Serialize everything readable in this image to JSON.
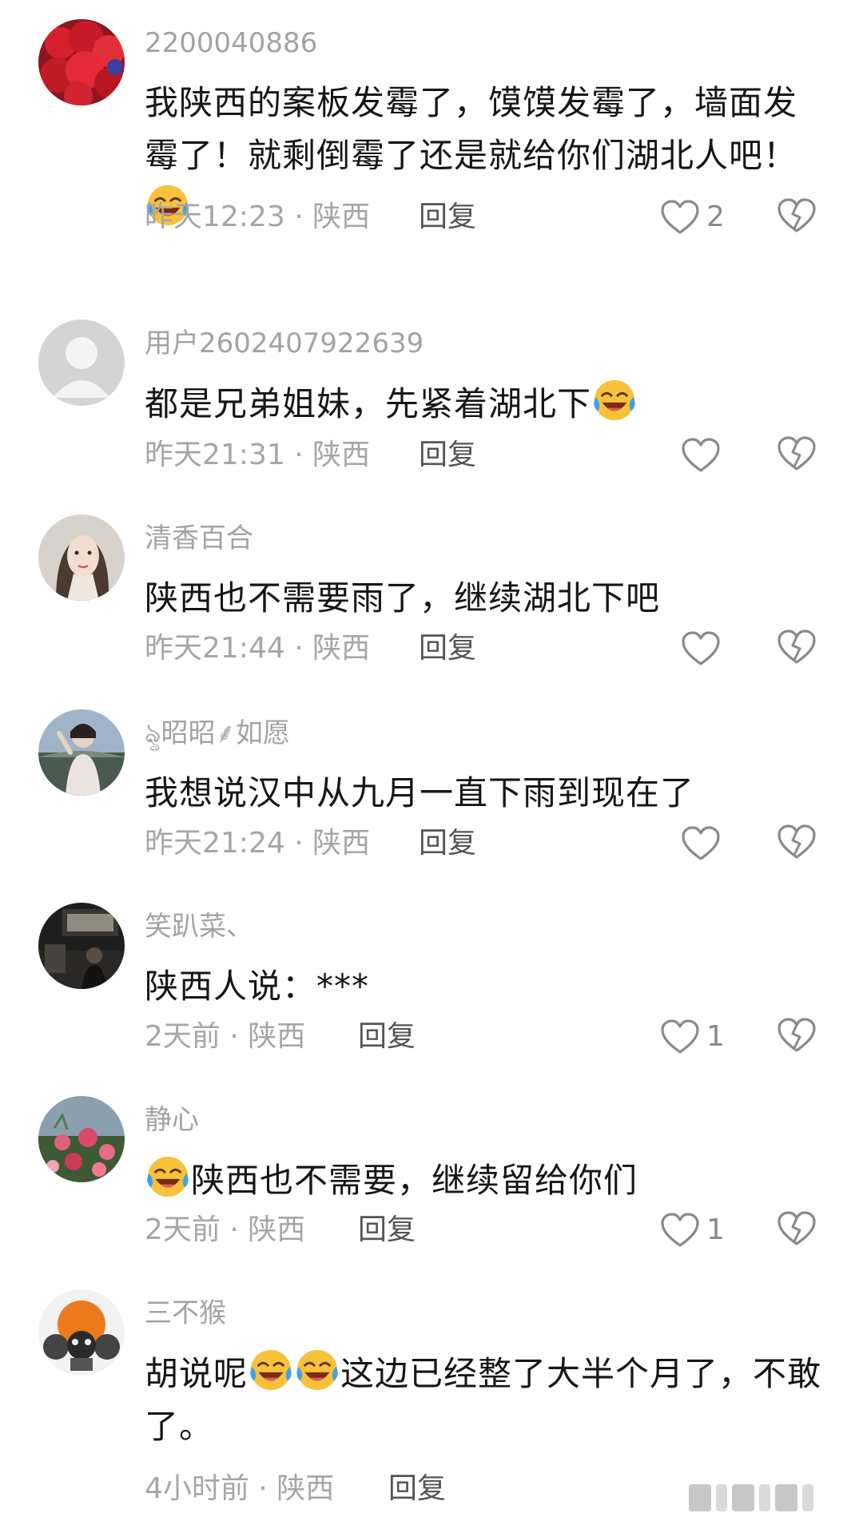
{
  "colors": {
    "username": "#a3a3a3",
    "meta": "#a6a6a6",
    "reply": "#555555",
    "body": "#161616",
    "icon_stroke": "#8a8a8a",
    "emoji_yellow": "#f7c23a",
    "emoji_tears": "#3ea0f0"
  },
  "comments": [
    {
      "username": "2200040886",
      "avatar_icon": "strawberry-photo-avatar",
      "text_parts": [
        "我陕西的案板发霉了，馍馍发霉了，墙面发霉了！就剩倒霉了还是就给你们湖北人吧！",
        ""
      ],
      "emoji": "laughing-crying-face-icon",
      "time": "昨天12:23",
      "location": "陕西",
      "reply_label": "回复",
      "likes": "2"
    },
    {
      "username": "用户2602407922639",
      "avatar_icon": "default-user-avatar",
      "text_parts": [
        "都是兄弟姐妹，先紧着湖北下",
        ""
      ],
      "emoji": "laughing-crying-face-icon",
      "time": "昨天21:31",
      "location": "陕西",
      "reply_label": "回复",
      "likes": ""
    },
    {
      "username": "清香百合",
      "avatar_icon": "woman-portrait-avatar",
      "text": "陕西也不需要雨了，继续湖北下吧",
      "time": "昨天21:44",
      "location": "陕西",
      "reply_label": "回复",
      "likes": ""
    },
    {
      "username": "ৡ昭昭⸙如愿",
      "avatar_icon": "girl-outdoor-avatar",
      "text": "我想说汉中从九月一直下雨到现在了",
      "time": "昨天21:24",
      "location": "陕西",
      "reply_label": "回复",
      "likes": ""
    },
    {
      "username": "笑趴菜、",
      "avatar_icon": "dark-room-avatar",
      "text": "陕西人说：***",
      "time": "2天前",
      "location": "陕西",
      "reply_label": "回复",
      "likes": "1"
    },
    {
      "username": "静心",
      "avatar_icon": "flowers-avatar",
      "text_parts": [
        "",
        "陕西也不需要，继续留给你们"
      ],
      "emoji": "laughing-crying-face-icon",
      "time": "2天前",
      "location": "陕西",
      "reply_label": "回复",
      "likes": "1"
    },
    {
      "username": "三不猴",
      "avatar_icon": "three-monkeys-avatar",
      "text_parts": [
        "胡说呢",
        "这边已经整了大半个月了，不敢了。"
      ],
      "emoji": "laughing-crying-face-icon",
      "time": "4小时前",
      "location": "陕西",
      "reply_label": "回复",
      "likes": ""
    }
  ],
  "separator": " · "
}
